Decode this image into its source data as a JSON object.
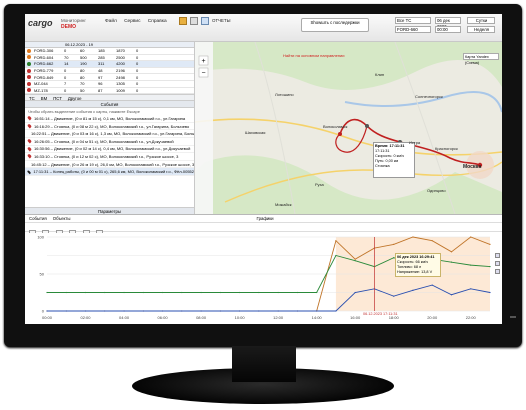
{
  "app": {
    "logo": "cargo",
    "brand": "Мониторинг",
    "demo": "DEMO",
    "menu": [
      "Файл",
      "Сервис",
      "Справка"
    ],
    "reports_label": "ОТЧЕТЫ",
    "map_button": "Showшть с последержки",
    "map_warning": "Найти на основном направлении",
    "vehicle_select": "Все ТС",
    "group_select": "FORD-660",
    "date_select": "06 дек 2023",
    "time_select": "00:00",
    "today_button": "Сутки",
    "week_button": "Неделя",
    "map_layer_select": "Карта Yandex (Схема)"
  },
  "vehicle_list": {
    "header_date": "06.12.2023 - 19",
    "rows": [
      {
        "name": "FORD-306",
        "c1": "0",
        "c2": "60",
        "c3": "185",
        "c4": "1870",
        "c5": "0",
        "color": "#e07a20"
      },
      {
        "name": "FORD-604",
        "c1": "70",
        "c2": "500",
        "c3": "285",
        "c4": "2500",
        "c5": "0",
        "color": "#e07a20"
      },
      {
        "name": "FORD-662",
        "c1": "14",
        "c2": "190",
        "c3": "311",
        "c4": "4200",
        "c5": "0",
        "color": "#2a7f2a"
      },
      {
        "name": "FORD-779",
        "c1": "0",
        "c2": "80",
        "c3": "48",
        "c4": "2196",
        "c5": "0",
        "color": "#c03030"
      },
      {
        "name": "FORD-849",
        "c1": "0",
        "c2": "80",
        "c3": "97",
        "c4": "2498",
        "c5": "0",
        "color": "#c03030"
      },
      {
        "name": "MZ-044",
        "c1": "7",
        "c2": "70",
        "c3": "96",
        "c4": "1305",
        "c5": "0",
        "color": "#c03030"
      },
      {
        "name": "MZ-178",
        "c1": "0",
        "c2": "50",
        "c3": "87",
        "c4": "1009",
        "c5": "0",
        "color": "#c03030"
      }
    ],
    "tabs": [
      "ТС",
      "ВМ",
      "ПСТ",
      "Другое"
    ],
    "events_title": "События",
    "events_hint": "Чтобы сбрать выделение события с карты, нажмите Escape"
  },
  "events": [
    {
      "text": "16:51:14 – Движение, (0 и 81 м 15 с), 0,1 км, МО, Волоколамский г.о., ул.Гагарина",
      "color": "#c03030"
    },
    {
      "text": "16:16:29 – Стоянка, (0 и 08 м 22 с), МО, Волоколамский г.о., ул.Гагарина, Болычево",
      "color": "#c03030"
    },
    {
      "text": "16:22:51 – Движение, (0 и 03 м 16 с), 1,3 км, МО, Волоколамский г.о., ул.Гагарина, Болычев",
      "color": "#c03030"
    },
    {
      "text": "16:26:05 – Стоянка, (0 и 04 м 51 с), МО, Волоколамский г.о., ул.Докучаевой",
      "color": "#c03030"
    },
    {
      "text": "16:30:56 – Движение, (0 и 02 м 14 с), 0,4 км, МО, Волоколамский г.о., ул.Докучаевой",
      "color": "#c03030"
    },
    {
      "text": "16:33:10 – Стоянка, (0 и 12 м 02 с), МО, Волоколамский г.о., Рузское шоссе, 3",
      "color": "#c03030"
    },
    {
      "text": "16:45:12 – Движение, (0 и 26 м 19 с), 26,0 км, МО, Волоколамский г.о., Рузское шоссе, 3",
      "color": "#c03030"
    },
    {
      "text": "17:11:31 – Конец работы, (0 и 00 м 01 с), 265,6 км, МО, Волоколамский г.о., Фёл-00552",
      "color": "#222"
    }
  ],
  "params_title": "Параметры",
  "chart_toolbar": [
    "События",
    "Объекты"
  ],
  "charts_title": "Графики",
  "chart_popup": {
    "title": "06 дек 2023 16:29:41",
    "lines": [
      "Скорость: 66 км/ч",
      "Топливо: 68 л",
      "Напряжение: 13,8 V"
    ]
  },
  "map_callout": {
    "title": "Время: 17:11:31",
    "lines": [
      "17:11:31",
      "Скорость: 0 км/ч",
      "Путь: 0,00 км",
      "Стоянка"
    ]
  },
  "map_labels": [
    "Москва",
    "Красногорск",
    "Одинцово",
    "Истра",
    "Солнечногорск",
    "Руза",
    "Можайск",
    "Клин",
    "Шаховская",
    "Лотошино",
    "Волоколамск"
  ],
  "chart_data": {
    "type": "line",
    "x": [
      "00:00",
      "01:00",
      "02:00",
      "03:00",
      "04:00",
      "05:00",
      "06:00",
      "07:00",
      "08:00",
      "09:00",
      "10:00",
      "11:00",
      "12:00",
      "13:00",
      "14:00",
      "15:00",
      "16:00",
      "17:00",
      "18:00",
      "19:00",
      "20:00",
      "21:00",
      "22:00",
      "23:00"
    ],
    "series": [
      {
        "name": "",
        "color": "#c0752a",
        "values": [
          0,
          0,
          0,
          0,
          0,
          0,
          0,
          0,
          0,
          0,
          0,
          0,
          0,
          0,
          0,
          95,
          70,
          85,
          90,
          100,
          95,
          80,
          100,
          90
        ]
      },
      {
        "name": "",
        "color": "#2a4fb0",
        "values": [
          0,
          0,
          0,
          0,
          0,
          0,
          0,
          0,
          0,
          0,
          0,
          0,
          0,
          0,
          0,
          0,
          25,
          30,
          20,
          28,
          35,
          22,
          30,
          25
        ]
      },
      {
        "name": "",
        "color": "#2a8a3a",
        "values": [
          25,
          25,
          25,
          25,
          25,
          25,
          25,
          25,
          25,
          25,
          25,
          25,
          25,
          25,
          25,
          75,
          68,
          60,
          72,
          65,
          70,
          66,
          62,
          60
        ]
      }
    ],
    "ylim": [
      0,
      100
    ],
    "xlabel": "",
    "ylabel": "",
    "grid": true,
    "marker_time": "06.12.2023 17:11:31"
  }
}
